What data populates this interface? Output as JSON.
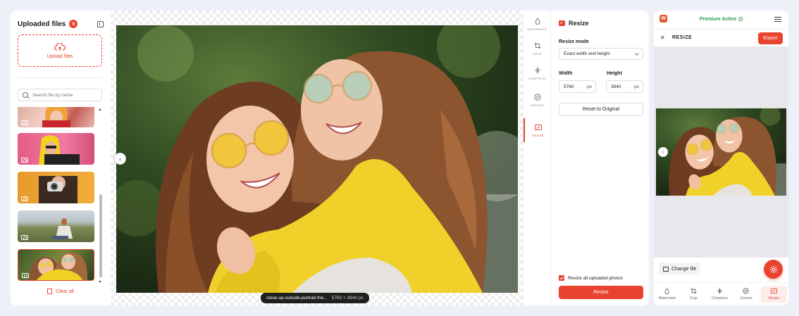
{
  "sidebar": {
    "title": "Uploaded files",
    "count": "9",
    "upload_label": "Upload files",
    "search_placeholder": "Search file by name",
    "clear_label": "Clear all"
  },
  "canvas": {
    "file_name": "close-up-outside-portrait-frie...",
    "dimensions": "5760 × 3840 px"
  },
  "tools": [
    {
      "label": "WATERMARK",
      "icon": "drop-icon"
    },
    {
      "label": "CROP",
      "icon": "crop-icon"
    },
    {
      "label": "COMPRESS",
      "icon": "compress-icon"
    },
    {
      "label": "CONVERT",
      "icon": "convert-icon"
    },
    {
      "label": "RESIZE",
      "icon": "resize-icon",
      "active": true
    }
  ],
  "resize": {
    "title": "Resize",
    "mode_label": "Resize mode",
    "mode_value": "Exact width and height",
    "width_label": "Width",
    "height_label": "Height",
    "width_value": "5760",
    "height_value": "3840",
    "unit": "px",
    "reset_label": "Reset to Original",
    "apply_all_label": "Resize all uploaded photos",
    "apply_all_checked": true,
    "resize_button": "Resize"
  },
  "mobile": {
    "logo": "W",
    "premium": "Premium Active",
    "title": "RESIZE",
    "export": "Export",
    "change_file": "Change file",
    "nav": [
      "Watermark",
      "Crop",
      "Compress",
      "Convert",
      "Resize"
    ]
  },
  "colors": {
    "accent": "#e8432e",
    "premium": "#2e9e4f"
  }
}
